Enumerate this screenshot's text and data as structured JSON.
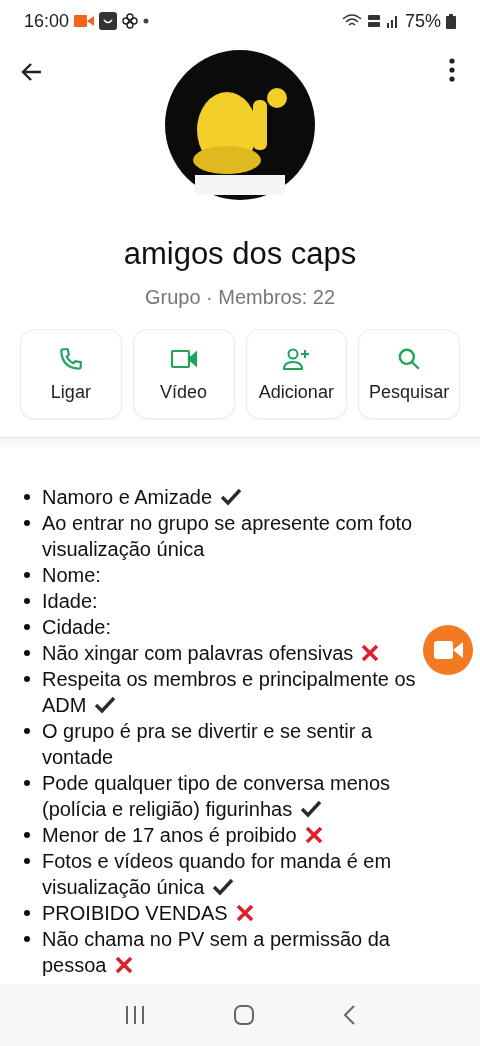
{
  "status_bar": {
    "time": "16:00",
    "battery": "75%"
  },
  "group": {
    "name": "amigos dos caps",
    "subtitle": "Grupo · Membros: 22"
  },
  "actions": [
    {
      "label": "Ligar",
      "kind": "call"
    },
    {
      "label": "Vídeo",
      "kind": "video"
    },
    {
      "label": "Adicionar",
      "kind": "add"
    },
    {
      "label": "Pesquisar",
      "kind": "search"
    }
  ],
  "rules": [
    {
      "text": "Namoro e Amizade",
      "kind": "check"
    },
    {
      "text": "Ao entrar no grupo se apresente com foto visualização única",
      "kind": "plain"
    },
    {
      "text": "Nome:",
      "kind": "plain"
    },
    {
      "text": "Idade:",
      "kind": "plain"
    },
    {
      "text": "Cidade:",
      "kind": "plain"
    },
    {
      "text": "Não xingar com palavras ofensivas",
      "kind": "cross"
    },
    {
      "text": "Respeita os membros e principalmente os ADM",
      "kind": "check"
    },
    {
      "text": "O grupo é pra se divertir e se sentir a vontade",
      "kind": "plain"
    },
    {
      "text": "Pode qualquer tipo de conversa menos (polícia e religião) figurinhas",
      "kind": "check"
    },
    {
      "text": "Menor de 17 anos é proibido",
      "kind": "cross"
    },
    {
      "text": "Fotos e vídeos quando for manda é em visualização única",
      "kind": "check"
    },
    {
      "text": "PROIBIDO VENDAS",
      "kind": "cross"
    },
    {
      "text": "Não chama no PV sem a permissão da pessoa",
      "kind": "cross"
    }
  ]
}
